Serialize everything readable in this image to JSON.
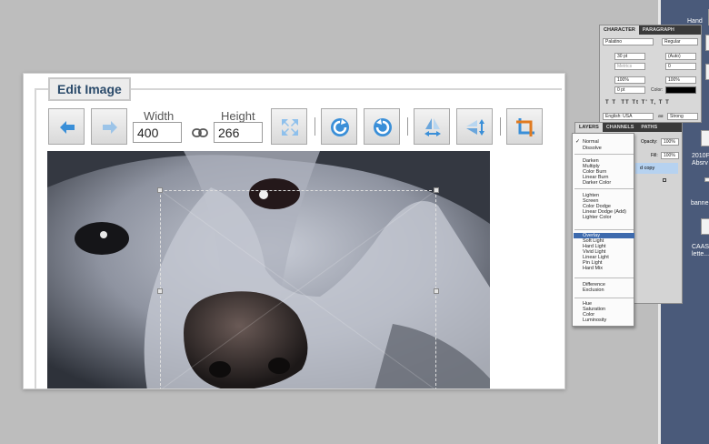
{
  "editor": {
    "title": "Edit Image",
    "width_label": "Width",
    "height_label": "Height",
    "width_value": "400",
    "height_value": "266"
  },
  "character_panel": {
    "tabs": [
      "CHARACTER",
      "PARAGRAPH"
    ],
    "font_family": "Palatino",
    "font_style": "Regular",
    "font_size": "30 pt",
    "leading": "(Auto)",
    "kerning": "Metrics",
    "tracking": "0",
    "vertical_scale": "100%",
    "horizontal_scale": "100%",
    "baseline_shift": "0 pt",
    "color_label": "Color:",
    "language": "English: USA",
    "anti_alias_label": "aa",
    "anti_alias": "Strong"
  },
  "layers_panel": {
    "tabs": [
      "LAYERS",
      "CHANNELS",
      "PATHS"
    ],
    "opacity_label": "Opacity:",
    "opacity_value": "100%",
    "fill_label": "Fill:",
    "fill_value": "100%",
    "layer_name": "d copy"
  },
  "blend_modes": {
    "items": [
      "Normal",
      "Dissolve",
      "Darken",
      "Multiply",
      "Color Burn",
      "Linear Burn",
      "Darker Color",
      "Lighten",
      "Screen",
      "Color Dodge",
      "Linear Dodge (Add)",
      "Lighter Color",
      "Overlay",
      "Soft Light",
      "Hard Light",
      "Vivid Light",
      "Linear Light",
      "Pin Light",
      "Hard Mix",
      "Difference",
      "Exclusion",
      "Hue",
      "Saturation",
      "Color",
      "Luminosity"
    ],
    "checked": "Normal",
    "highlighted": "Overlay"
  },
  "desktop": {
    "labels": [
      "2010Ph Absrv",
      "banne",
      "CAAS lette...",
      "Hand"
    ]
  },
  "colors": {
    "accent_blue": "#3a8fd8",
    "title_text": "#2a4a6a",
    "menu_highlight": "#3d6aad",
    "desktop": "#4a5a7a"
  }
}
